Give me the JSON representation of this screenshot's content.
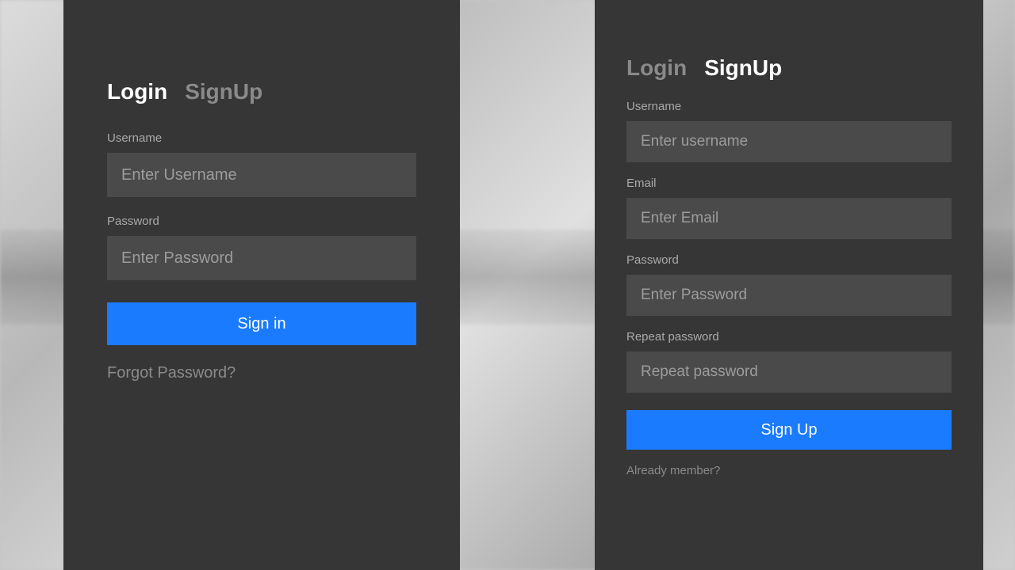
{
  "colors": {
    "panel_bg": "#363636",
    "input_bg": "#4a4a4a",
    "primary": "#1a7bff",
    "text_active": "#ffffff",
    "text_muted": "#8a8a8a"
  },
  "login_panel": {
    "tabs": {
      "login_label": "Login",
      "signup_label": "SignUp"
    },
    "username": {
      "label": "Username",
      "placeholder": "Enter Username",
      "value": ""
    },
    "password": {
      "label": "Password",
      "placeholder": "Enter Password",
      "value": ""
    },
    "submit_label": "Sign in",
    "forgot_label": "Forgot Password?"
  },
  "signup_panel": {
    "tabs": {
      "login_label": "Login",
      "signup_label": "SignUp"
    },
    "username": {
      "label": "Username",
      "placeholder": "Enter username",
      "value": ""
    },
    "email": {
      "label": "Email",
      "placeholder": "Enter Email",
      "value": ""
    },
    "password": {
      "label": "Password",
      "placeholder": "Enter Password",
      "value": ""
    },
    "repeat_password": {
      "label": "Repeat password",
      "placeholder": "Repeat password",
      "value": ""
    },
    "submit_label": "Sign Up",
    "already_label": "Already member?"
  }
}
